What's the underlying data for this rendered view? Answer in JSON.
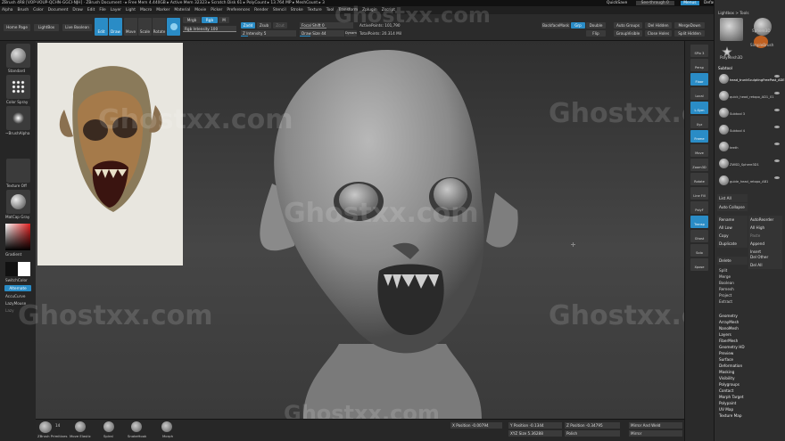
{
  "title_bar": "ZBrush 4R8 [VOP-VOUP-QCHN-GGCI-NJH] · ZBrush Document · ▸ Free Mem 4.440GB ▸ Active Mem 32323 ▸ Scratch Disk 61 ▸ PolyCount ▸ 13.764 MP ▸ MeshCount ▸ 3",
  "top_right": {
    "quicksave": "QuickSave",
    "see_through": "See-through 0",
    "menus": "Menus",
    "default_zscript": "DefaultZScript"
  },
  "menu": [
    "Alpha",
    "Brush",
    "Color",
    "Document",
    "Draw",
    "Edit",
    "File",
    "Layer",
    "Light",
    "Macro",
    "Marker",
    "Material",
    "Movie",
    "Picker",
    "Preferences",
    "Render",
    "Stencil",
    "Stroke",
    "Texture",
    "Tool",
    "Transform",
    "Zplugin",
    "Zscript"
  ],
  "top": {
    "home_page": "Home Page",
    "lightbox": "LightBox",
    "live_boolean": "Live Boolean",
    "edit": "Edit",
    "draw": "Draw",
    "move": "Move",
    "scale": "Scale",
    "rotate": "Rotate",
    "mrgb": "Mrgb",
    "rgb": "Rgb",
    "m": "M",
    "zadd": "Zadd",
    "zsub": "Zsub",
    "zcut": "Zcut",
    "rgb_intensity": "Rgb Intensity 100",
    "z_intensity": "Z Intensity 5",
    "focal_shift": "Focal Shift 0",
    "draw_size": "Draw Size 44",
    "dynamic": "Dynamic",
    "active_points": "ActivePoints: 101,790",
    "total_points": "TotalPoints: 20.314 Mil",
    "backface_mask": "BackfaceMask",
    "grp": "Grp",
    "double": "Double",
    "flip": "Flip",
    "auto_groups": "Auto Groups",
    "group_visible": "GroupVisible",
    "del_hidden": "Del Hidden",
    "close_holes": "Close Holes",
    "merge_down": "MergeDown",
    "split_hidden": "Split Hidden"
  },
  "left": {
    "standard": "Standard",
    "color_spray": "Color Spray",
    "brush_alpha": "~BrushAlpha",
    "texture_off": "Texture Off",
    "matcap_gray": "MatCap Gray",
    "gradient": "Gradient",
    "switch_color": "SwitchColor",
    "alternate": "Alternate",
    "accucurve": "AccuCurve",
    "lazy_mouse": "LazyMouse",
    "lazy": "Lazy"
  },
  "bottom": {
    "zbrush_primitives": "ZBrush Primitives",
    "move_elastic": "Move Elastic",
    "spiral": "Spiral",
    "snakehook": "SnakeHook",
    "morph": "Morph",
    "brush_count": "14",
    "x_position": "X Position -0.00794",
    "y_position": "Y Position -0.1344",
    "z_position": "Z Position -0.34795",
    "xyz_size": "XYZ Size 5.36288",
    "mirror": "Mirror",
    "mirror_and_weld": "Mirror And Weld",
    "polish": "Polish"
  },
  "right_shelf": [
    "SPix 3",
    "Persp",
    "Floor",
    "Local",
    "L.Sym",
    "Xyz",
    "Frame",
    "Move",
    "Zoom3D",
    "Rotate",
    "Line Fill",
    "PolyF",
    "Transp",
    "Ghost",
    "Solo",
    "Xpose"
  ],
  "tray": {
    "lightbox_tools": "Lightbox > Tools",
    "tool_names": [
      "Sphere3D",
      "SimpleBrush",
      "PolyMesh3D"
    ],
    "subtool_title": "Subtool",
    "subtools": [
      "head_trunkSculptingFreePost_ADE",
      "quick_head_retopo_AD1_01",
      "Subtool 3",
      "Subtool 4",
      "teeth",
      "ZWSD_Sphere3D1",
      "guide_head_retopo_AB1"
    ],
    "list_all": "List All",
    "auto_collapse": "Auto Collapse",
    "rename": "Rename",
    "auto_reorder": "AutoReorder",
    "all_low": "All Low",
    "all_high": "All High",
    "copy": "Copy",
    "paste": "Paste",
    "duplicate": "Duplicate",
    "append": "Append",
    "insert": "Insert",
    "del_other": "Del Other",
    "delete": "Delete",
    "del_all": "Del All",
    "actions": [
      "Split",
      "Merge",
      "Boolean",
      "Remesh",
      "Project",
      "Extract"
    ],
    "subpalettes": [
      "Geometry",
      "ArrayMesh",
      "NanoMesh",
      "Layers",
      "FiberMesh",
      "Geometry HD",
      "Preview",
      "Surface",
      "Deformation",
      "Masking",
      "Visibility",
      "Polygroups",
      "Contact",
      "Morph Target",
      "Polypaint",
      "UV Map",
      "Texture Map"
    ]
  },
  "watermark": "Ghostxx.com",
  "colors": {
    "accent": "#2a8cc6",
    "panel": "#2b2b2b",
    "canvas_top": "#2f2f2f",
    "canvas_bottom": "#464646"
  }
}
